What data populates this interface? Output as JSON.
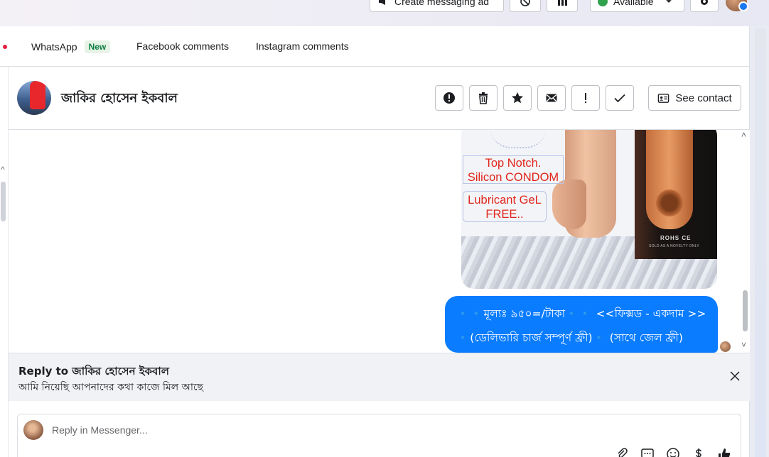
{
  "topbar": {
    "create_ad_label": "Create messaging ad",
    "status_label": "Available"
  },
  "tabs": {
    "whatsapp": "WhatsApp",
    "whatsapp_badge": "New",
    "facebook": "Facebook comments",
    "instagram": "Instagram comments"
  },
  "contact": {
    "name": "জাকির হোসেন ইকবাল",
    "see_contact_label": "See contact"
  },
  "image": {
    "label1_line1": "Top Notch.",
    "label1_line2": "Silicon CONDOM",
    "label2_line1": "Lubricant GeL",
    "label2_line2": "FREE..",
    "box_text": "ROHS CE",
    "box_subtext": "SOLD AS A NOVELTY ONLY"
  },
  "message": {
    "line1": "🔹🔹মূল্যঃ ৯৫০=/টাকা🔹🔹 <<ফিক্সড - একদাম >>",
    "line2": "🔹(ডেলিভারি চার্জ সম্পূর্ণ ফ্রী)🔹 (সাথে জেল ফ্রী)"
  },
  "reply": {
    "title": "Reply to জাকির হোসেন ইকবাল",
    "quoted_text": "আমি নিয়েছি আপনাদের কথা কাজে মিল আছে"
  },
  "composer": {
    "placeholder": "Reply in Messenger..."
  },
  "colors": {
    "bubble": "#0a7cff",
    "accent_red": "#e41e3f",
    "badge_green": "#0a7c3e"
  }
}
